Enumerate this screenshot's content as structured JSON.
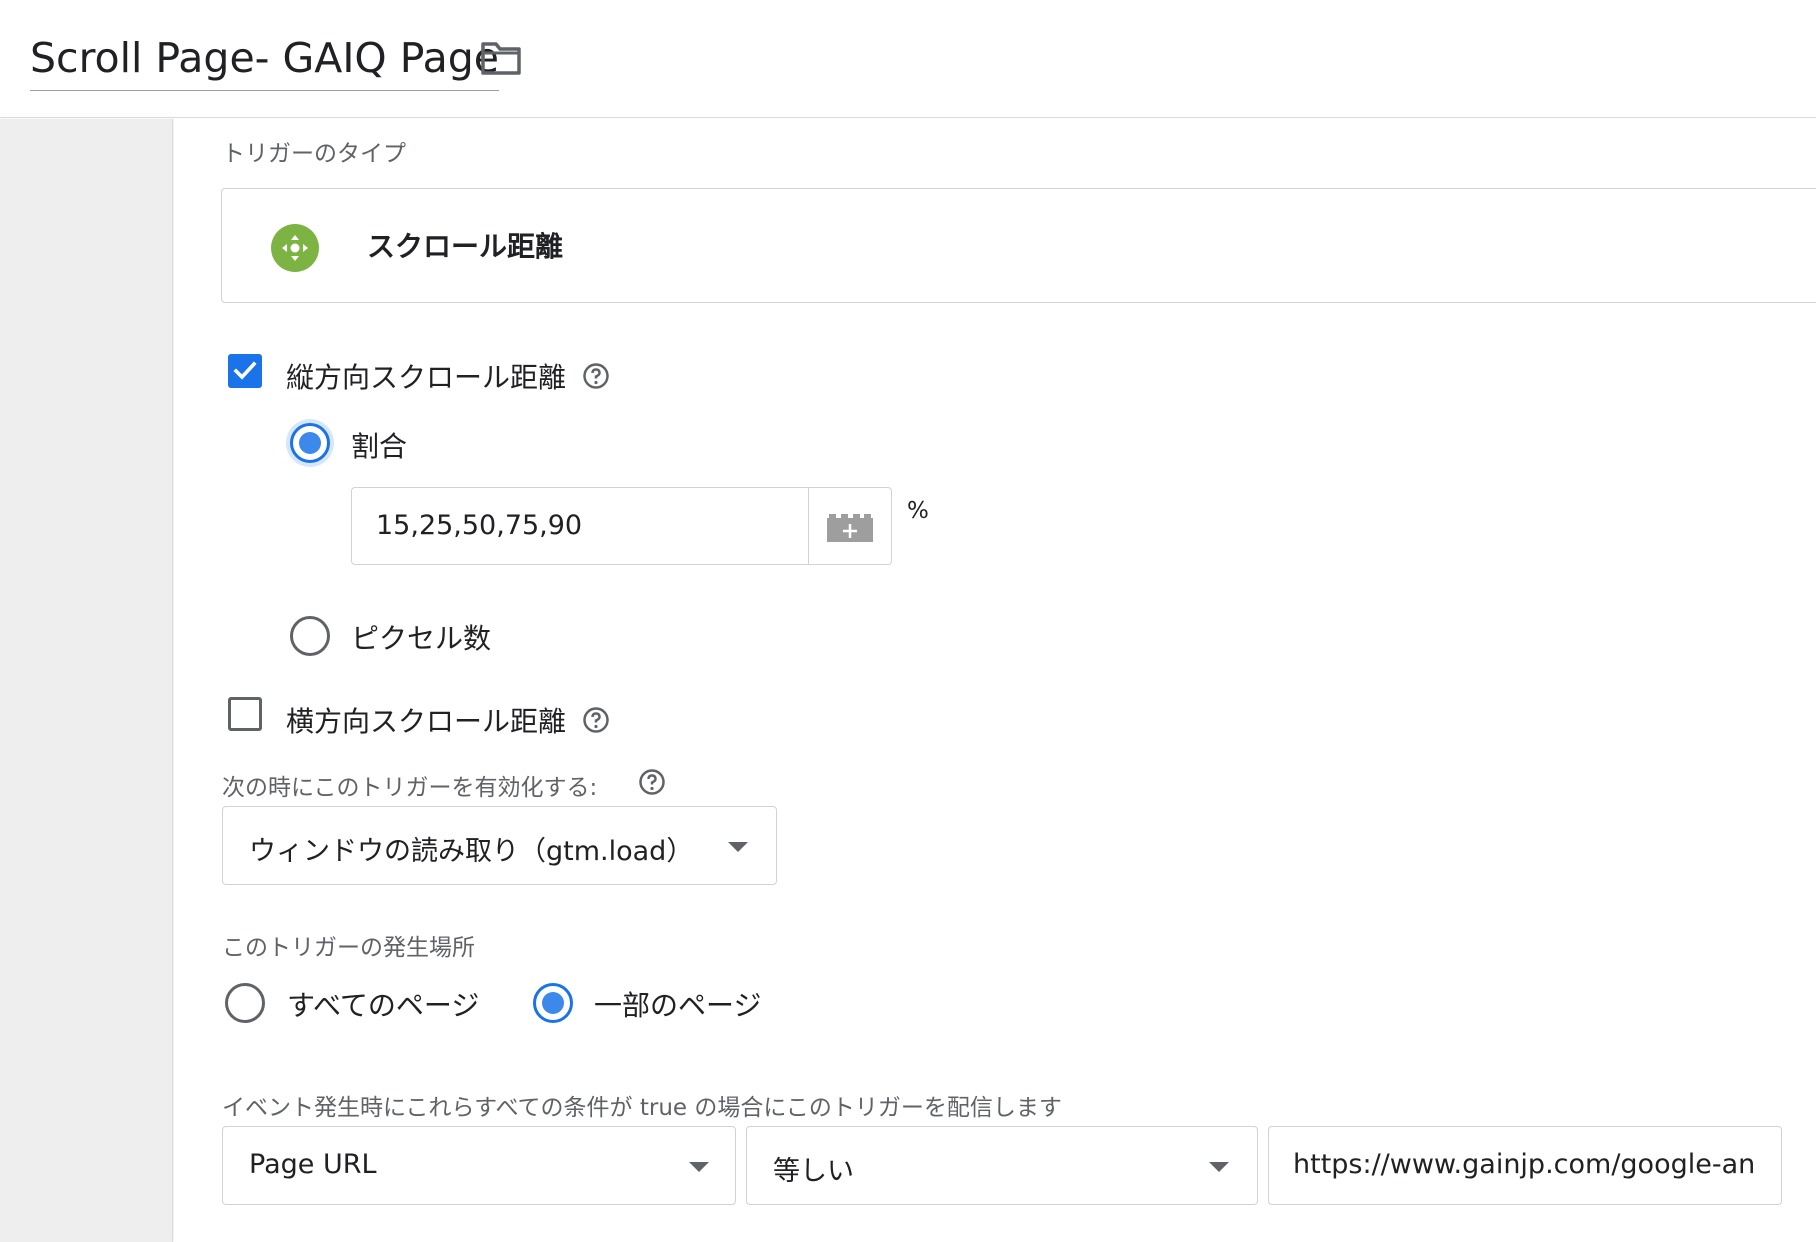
{
  "header": {
    "title": "Scroll Page- GAIQ Page",
    "folder_icon": "folder-icon"
  },
  "trigger_type": {
    "label": "トリガーのタイプ",
    "name": "スクロール距離",
    "icon": "scroll-move-icon",
    "icon_color": "#7cb342"
  },
  "vertical": {
    "label": "縦方向スクロール距離",
    "checked": true,
    "percent_option": "割合",
    "percent_selected": true,
    "percent_value": "15,25,50,75,90",
    "percent_unit": "%",
    "pixel_option": "ピクセル数",
    "pixel_selected": false
  },
  "horizontal": {
    "label": "横方向スクロール距離",
    "checked": false
  },
  "enable_when": {
    "label": "次の時にこのトリガーを有効化する:",
    "value": "ウィンドウの読み取り（gtm.load）"
  },
  "fires_on": {
    "label": "このトリガーの発生場所",
    "all_pages": "すべてのページ",
    "some_pages": "一部のページ",
    "selected": "some_pages"
  },
  "conditions": {
    "label": "イベント発生時にこれらすべての条件が true の場合にこのトリガーを配信します",
    "variable": "Page URL",
    "operator": "等しい",
    "value": "https://www.gainjp.com/google-an"
  },
  "colors": {
    "accent": "#1a73e8",
    "trigger_icon": "#7cb342"
  }
}
